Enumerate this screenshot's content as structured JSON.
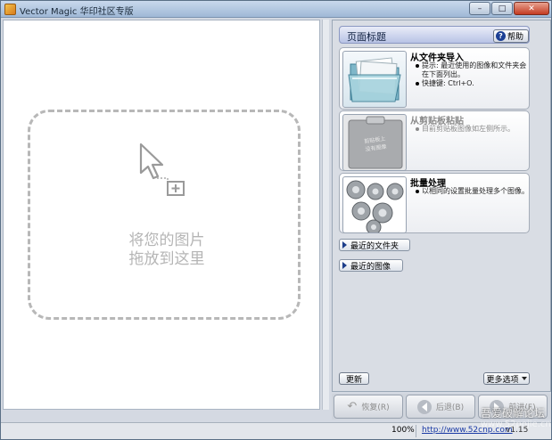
{
  "window": {
    "title": "Vector Magic 华印社区专版",
    "controls": {
      "minimize": "–",
      "maximize": "□",
      "close": "✕"
    }
  },
  "dropzone": {
    "line1": "将您的图片",
    "line2": "拖放到这里"
  },
  "panel": {
    "title": "页面标题",
    "help_label": "帮助",
    "cards": [
      {
        "title": "从文件夹导入",
        "bullets": [
          "提示: 最近使用的图像和文件夹会在下面列出。",
          "快捷键:  Ctrl+O."
        ],
        "icon": "folder-icon",
        "enabled": true
      },
      {
        "title": "从剪贴板粘贴",
        "bullets": [
          "目前剪贴板图像如左侧所示。"
        ],
        "thumb_line1": "剪贴板上",
        "thumb_line2": "没有图像",
        "icon": "clipboard-icon",
        "enabled": false
      },
      {
        "title": "批量处理",
        "bullets": [
          "以相同的设置批量处理多个图像。"
        ],
        "icon": "gears-icon",
        "enabled": true
      }
    ],
    "recent_folders_label": "最近的文件夹",
    "recent_images_label": "最近的图像",
    "update_label": "更新",
    "more_options_label": "更多选项"
  },
  "nav": {
    "restore_label": "恢复(R)",
    "back_label": "后退(B)",
    "forward_label": "前进(F)"
  },
  "status": {
    "zoom": "100%",
    "url": "http://www.52cnp.com",
    "version": "v1.15"
  },
  "watermark": {
    "line1": "吾爱破解论坛",
    "line2": "www.52pojie.cn"
  },
  "colors": {
    "accent": "#1b3f94",
    "titlebar": "#9fb8d6",
    "close": "#c43b22"
  }
}
